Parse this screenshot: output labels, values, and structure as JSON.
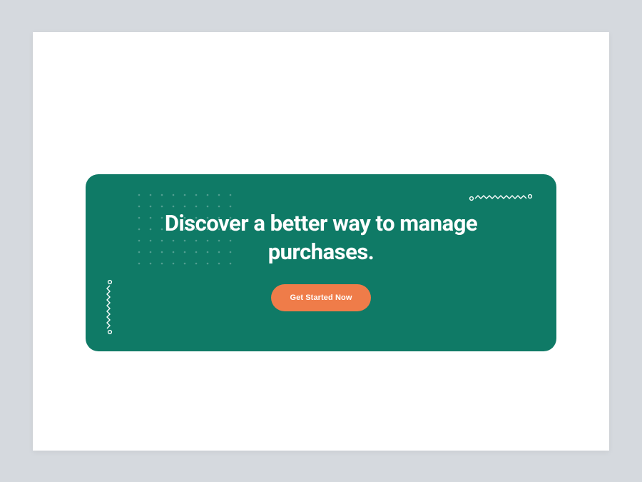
{
  "hero": {
    "headline": "Discover a better way to manage purchases.",
    "cta_label": "Get Started Now"
  },
  "colors": {
    "card_bg": "#0f7a66",
    "cta_bg": "#ef7c49",
    "page_bg": "#d5d9de",
    "frame_bg": "#ffffff"
  }
}
